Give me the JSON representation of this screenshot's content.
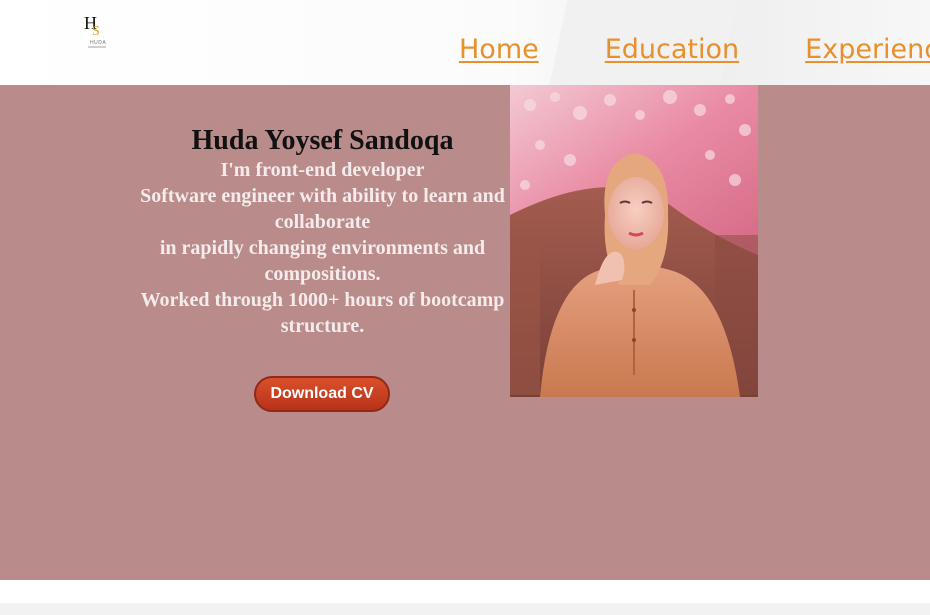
{
  "logo": {
    "h": "H",
    "s": "S",
    "sub": "HUDA"
  },
  "nav": {
    "items": [
      "Home",
      "Education",
      "Experience"
    ]
  },
  "hero": {
    "name": "Huda Yoysef Sandoqa",
    "bio_lines": [
      "I'm front-end developer",
      "Software engineer with ability to learn and collaborate",
      "in rapidly changing environments and compositions.",
      "Worked through 1000+ hours of bootcamp structure."
    ],
    "cv_button": "Download CV"
  },
  "colors": {
    "hero_background": "#b98b8a",
    "nav_link": "#e8902c",
    "button": "#c9401f"
  }
}
